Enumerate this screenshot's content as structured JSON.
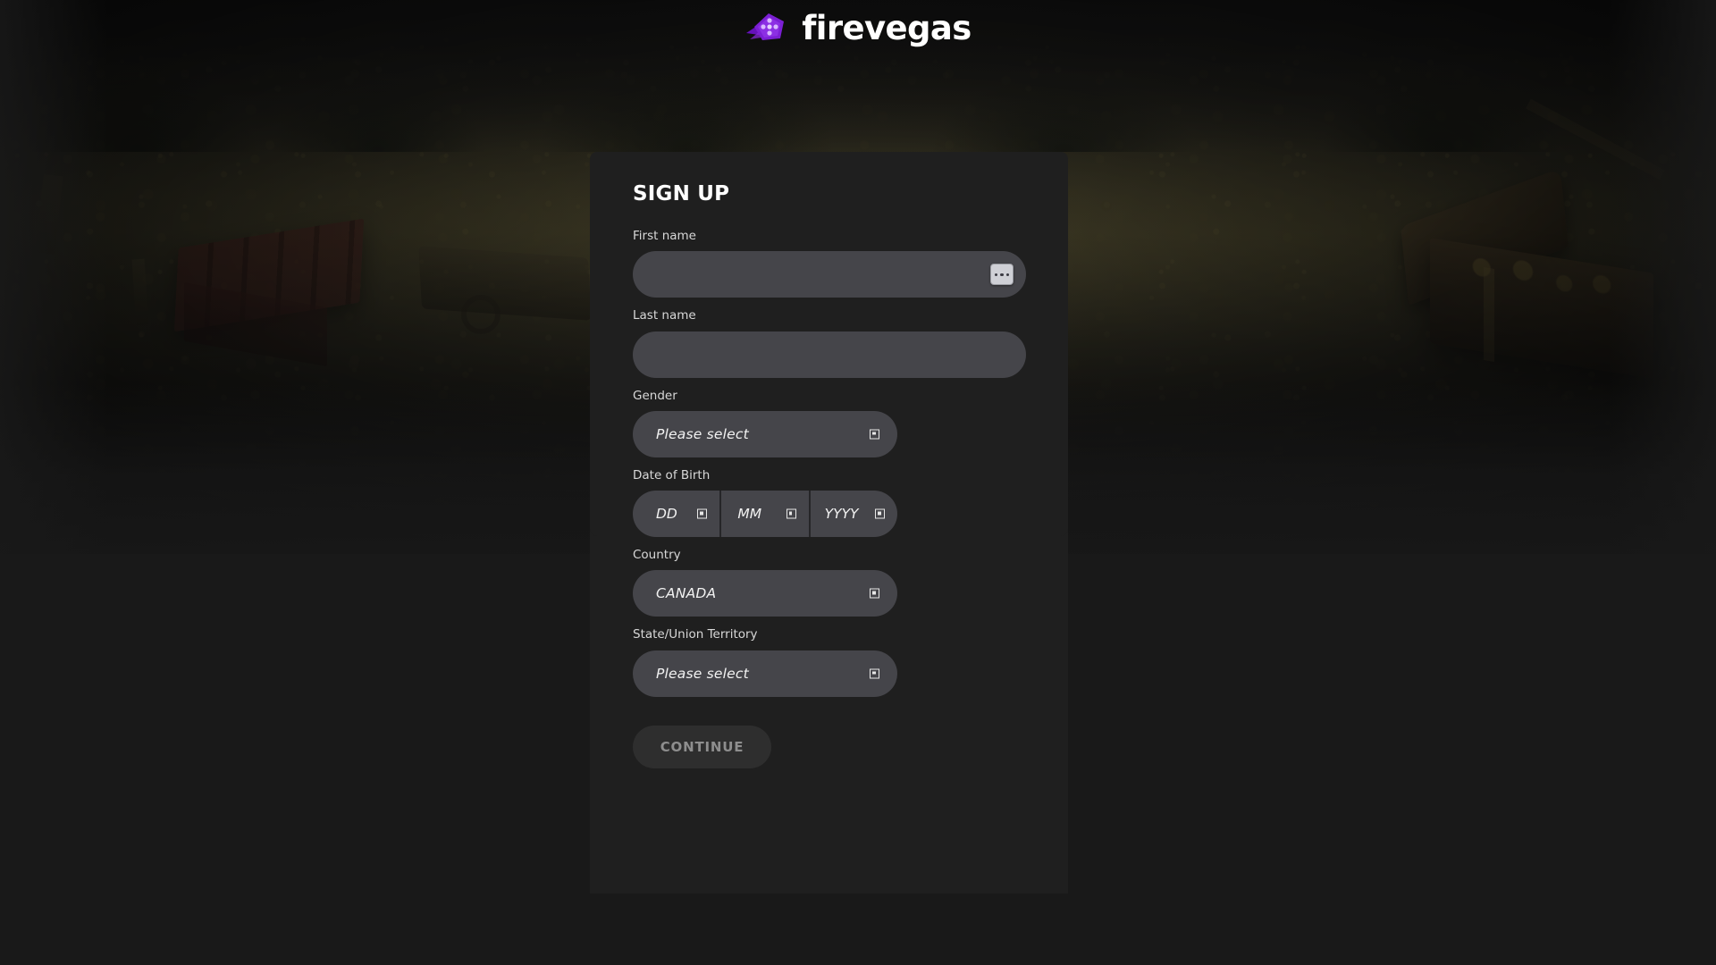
{
  "brand": {
    "name": "firevegas",
    "logo_icon": "firevegas-diamond-logo-icon",
    "accent_color": "#7b1fd4",
    "accent_light": "#a855f7"
  },
  "card": {
    "title": "SIGN UP"
  },
  "fields": {
    "first_name": {
      "label": "First name",
      "value": "",
      "placeholder": "",
      "autofill_icon": "autofill-dots-icon"
    },
    "last_name": {
      "label": "Last name",
      "value": "",
      "placeholder": ""
    },
    "gender": {
      "label": "Gender",
      "value": "Please select",
      "caret_icon": "dropdown-caret-icon"
    },
    "date_of_birth": {
      "label": "Date of Birth",
      "day": "DD",
      "month": "MM",
      "year": "YYYY"
    },
    "country": {
      "label": "Country",
      "value": "CANADA",
      "caret_icon": "dropdown-caret-icon"
    },
    "state": {
      "label": "State/Union Territory",
      "value": "Please select",
      "caret_icon": "dropdown-caret-icon"
    }
  },
  "actions": {
    "continue_label": "CONTINUE"
  },
  "theme": {
    "page_bg": "#191919",
    "card_bg": "#1f1f1f",
    "input_bg": "#45454a",
    "label_color": "#d8d8d8",
    "button_bg": "#2e2e2e",
    "button_text": "#8e8e8e"
  }
}
